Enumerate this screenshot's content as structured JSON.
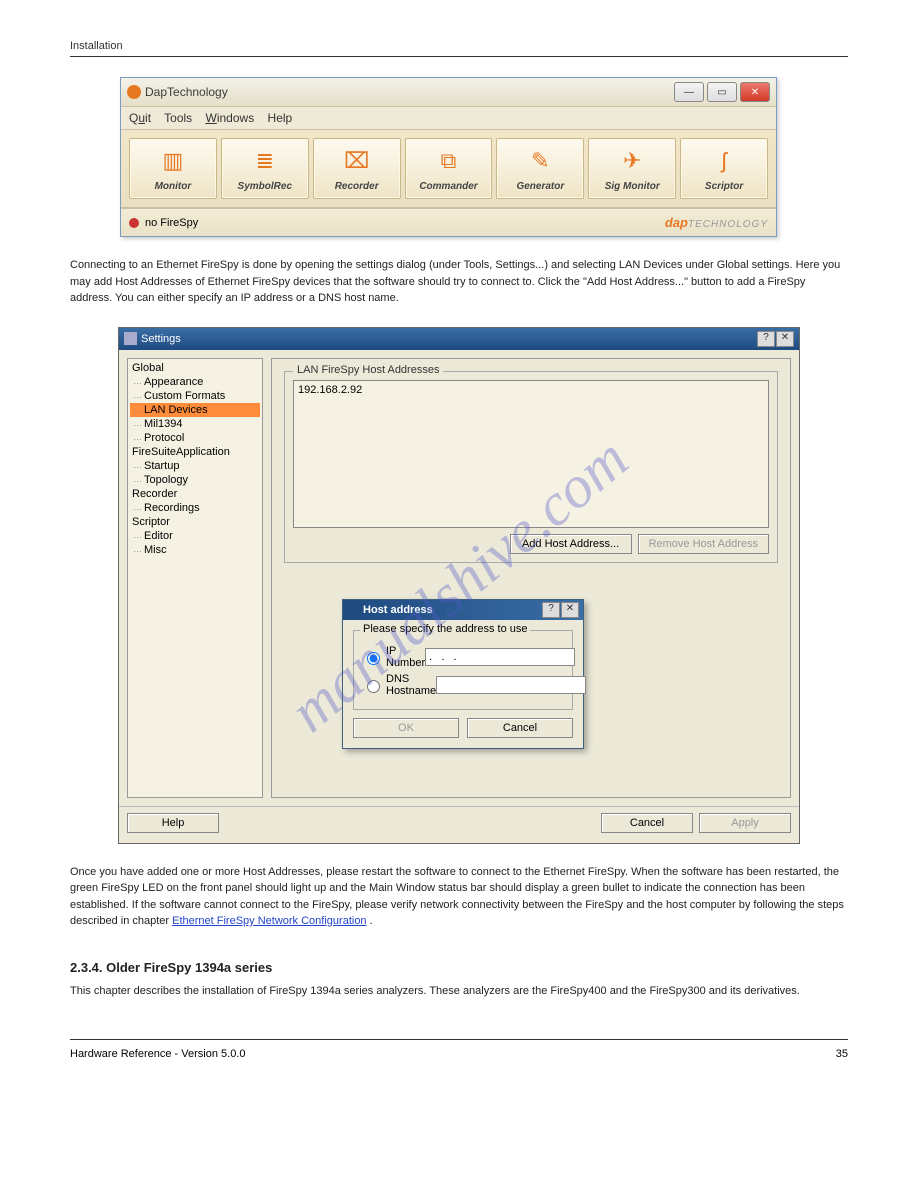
{
  "header": {
    "left": "Installation",
    "right": ""
  },
  "app": {
    "title": "DapTechnology",
    "menu": [
      "Quit",
      "Tools",
      "Windows",
      "Help"
    ],
    "tools": [
      {
        "label": "Monitor",
        "icon": "▥"
      },
      {
        "label": "SymbolRec",
        "icon": "≣"
      },
      {
        "label": "Recorder",
        "icon": "⌧"
      },
      {
        "label": "Commander",
        "icon": "⧉"
      },
      {
        "label": "Generator",
        "icon": "✎"
      },
      {
        "label": "Sig Monitor",
        "icon": "✈"
      },
      {
        "label": "Scriptor",
        "icon": "ʃ"
      }
    ],
    "status": "no FireSpy",
    "brand1": "dap",
    "brand2": "TECHNOLOGY"
  },
  "body1": "Connecting to an Ethernet FireSpy is done by opening the settings dialog (under Tools, Settings...) and selecting LAN Devices under Global settings. Here you may add Host Addresses of Ethernet FireSpy devices that the software should try to connect to. Click the \"Add Host Address...\" button to add a FireSpy address. You can either specify an IP address or a DNS host name.",
  "settings": {
    "title": "Settings",
    "tree": {
      "Global": [
        "Appearance",
        "Custom Formats",
        "LAN Devices",
        "Mil1394",
        "Protocol"
      ],
      "FireSuiteApplication": [
        "Startup",
        "Topology"
      ],
      "Recorder": [
        "Recordings"
      ],
      "Scriptor": [
        "Editor",
        "Misc"
      ]
    },
    "selected": "LAN Devices",
    "groupTitle": "LAN FireSpy Host Addresses",
    "hostEntry": "192.168.2.92",
    "addBtn": "Add Host Address...",
    "removeBtn": "Remove Host Address",
    "help": "Help",
    "cancel": "Cancel",
    "apply": "Apply"
  },
  "dialog": {
    "title": "Host address",
    "legend": "Please specify the address to use",
    "opt1": "IP Number",
    "opt2": "DNS Hostname",
    "ipVal": ".   .   .",
    "ok": "OK",
    "cancel": "Cancel"
  },
  "body2a": "Once you have added one or more Host Addresses, please restart the software to connect to the Ethernet FireSpy. When the software has been restarted, the green FireSpy LED on the front panel should light up and the Main Window status bar should display a green bullet to indicate the connection has been established. If the software cannot connect to the FireSpy, please verify network connectivity between the FireSpy and the host computer by following the steps described in chapter ",
  "body2link": "Ethernet FireSpy Network Configuration",
  "body2b": ".",
  "section": "2.3.4. Older FireSpy 1394a series",
  "body3": "This chapter describes the installation of FireSpy 1394a series analyzers. These analyzers are the FireSpy400 and the FireSpy300 and its derivatives.",
  "watermark": "manualshive.com",
  "footer": {
    "left": "Hardware Reference - Version 5.0.0",
    "right": "35"
  }
}
